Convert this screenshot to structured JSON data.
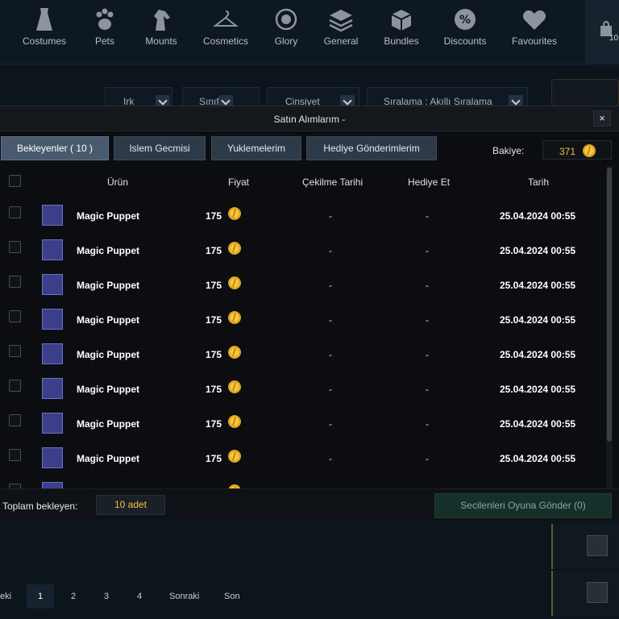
{
  "nav": {
    "items": [
      {
        "label": "Costumes",
        "icon": "dress-icon"
      },
      {
        "label": "Pets",
        "icon": "paw-icon"
      },
      {
        "label": "Mounts",
        "icon": "horse-icon"
      },
      {
        "label": "Cosmetics",
        "icon": "hanger-icon"
      },
      {
        "label": "Glory",
        "icon": "glory-icon"
      },
      {
        "label": "General",
        "icon": "layers-icon"
      },
      {
        "label": "Bundles",
        "icon": "box-icon"
      },
      {
        "label": "Discounts",
        "icon": "percent-badge-icon"
      },
      {
        "label": "Favourites",
        "icon": "heart-icon"
      }
    ],
    "cart_count": "10"
  },
  "filters": {
    "race": "Irk",
    "class": "Sınıf",
    "gender": "Cinsiyet",
    "sort": "Sıralama : Akıllı Sıralama"
  },
  "modal": {
    "title": "Satın Alımlarım -",
    "close": "×",
    "tabs": [
      "Bekleyenler ( 10 )",
      "Islem Gecmisi",
      "Yuklemelerim",
      "Hediye Gönderimlerim"
    ],
    "active_tab": 0,
    "balance_label": "Bakiye:",
    "balance_value": "371",
    "columns": {
      "product": "Ürün",
      "price": "Fiyat",
      "withdraw_date": "Çekilme Tarihi",
      "gift": "Hediye Et",
      "date": "Tarih"
    },
    "rows": [
      {
        "name": "Magic Puppet",
        "price": "175",
        "withdraw": "-",
        "gift": "-",
        "date": "25.04.2024 00:55"
      },
      {
        "name": "Magic Puppet",
        "price": "175",
        "withdraw": "-",
        "gift": "-",
        "date": "25.04.2024 00:55"
      },
      {
        "name": "Magic Puppet",
        "price": "175",
        "withdraw": "-",
        "gift": "-",
        "date": "25.04.2024 00:55"
      },
      {
        "name": "Magic Puppet",
        "price": "175",
        "withdraw": "-",
        "gift": "-",
        "date": "25.04.2024 00:55"
      },
      {
        "name": "Magic Puppet",
        "price": "175",
        "withdraw": "-",
        "gift": "-",
        "date": "25.04.2024 00:55"
      },
      {
        "name": "Magic Puppet",
        "price": "175",
        "withdraw": "-",
        "gift": "-",
        "date": "25.04.2024 00:55"
      },
      {
        "name": "Magic Puppet",
        "price": "175",
        "withdraw": "-",
        "gift": "-",
        "date": "25.04.2024 00:55"
      },
      {
        "name": "Magic Puppet",
        "price": "175",
        "withdraw": "-",
        "gift": "-",
        "date": "25.04.2024 00:55"
      }
    ],
    "footer": {
      "total_label": "Toplam bekleyen:",
      "total_value": "10 adet",
      "send_button": "Secilenleri Oyuna Gönder (0)"
    }
  },
  "pagination": {
    "prev": "eki",
    "pages": [
      "1",
      "2",
      "3",
      "4"
    ],
    "active_page": "1",
    "next": "Sonraki",
    "last": "Son"
  },
  "colors": {
    "gold": "#f3c33a",
    "tab_active": "#4a5a6e",
    "tab": "#2f3a49",
    "send_button_bg": "#15302a"
  }
}
